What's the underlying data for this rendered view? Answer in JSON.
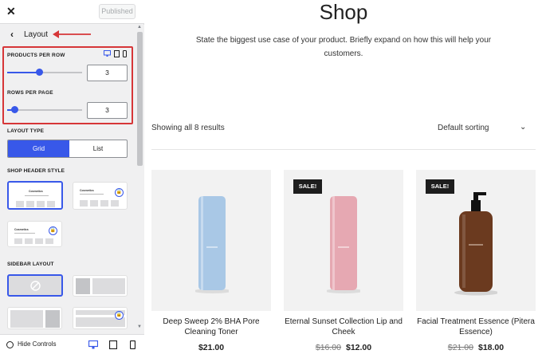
{
  "customizer": {
    "close_glyph": "✕",
    "publish_label": "Published",
    "section_title": "Layout",
    "back_glyph": "‹",
    "products_per_row": {
      "label": "PRODUCTS PER ROW",
      "value": "3",
      "slider_fraction": 0.43
    },
    "rows_per_page": {
      "label": "ROWS PER PAGE",
      "value": "3",
      "slider_fraction": 0.1
    },
    "layout_type": {
      "label": "LAYOUT TYPE",
      "options": [
        "Grid",
        "List"
      ],
      "selected": "Grid"
    },
    "shop_header_style": {
      "label": "SHOP HEADER STYLE",
      "thumb_title": "Cosmetics"
    },
    "sidebar_layout": {
      "label": "SIDEBAR LAYOUT"
    },
    "hide_controls_label": "Hide Controls",
    "accent": "#3858e9",
    "highlight": "#d63638"
  },
  "shop": {
    "title": "Shop",
    "description": "State the biggest use case of your product. Briefly expand on how this will help your customers.",
    "results_text": "Showing all 8 results",
    "sort_label": "Default sorting",
    "products": [
      {
        "name": "Deep Sweep 2% BHA Pore Cleaning Toner",
        "price": "$21.00",
        "old_price": "",
        "sale": "",
        "bottle_color": "#a9c8e6"
      },
      {
        "name": "Eternal Sunset Collection Lip and Cheek",
        "price": "$12.00",
        "old_price": "$16.00",
        "sale": "SALE!",
        "bottle_color": "#e6a8b2"
      },
      {
        "name": "Facial Treatment Essence (Pitera Essence)",
        "price": "$18.00",
        "old_price": "$21.00",
        "sale": "SALE!",
        "bottle_color": "#6b3a1f"
      }
    ]
  }
}
